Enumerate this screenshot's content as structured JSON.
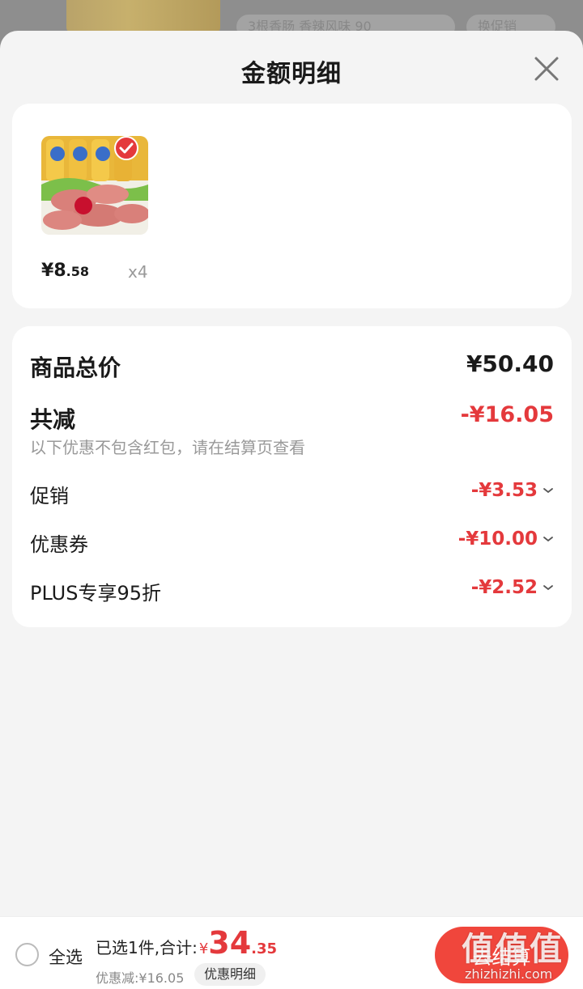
{
  "background": {
    "pill_1": "3根香肠 香辣风味 90",
    "pill_2": "换促销"
  },
  "sheet": {
    "title": "金额明细",
    "close_icon": "close-icon"
  },
  "product": {
    "price_symbol": "¥",
    "price_int": "8",
    "price_dec": ".58",
    "quantity": "x4",
    "selected": true
  },
  "summary": {
    "total_label": "商品总价",
    "total_value": "¥50.40",
    "reduce_label": "共减",
    "reduce_value": "-¥16.05",
    "note": "以下优惠不包含红包，请在结算页查看",
    "items": [
      {
        "label": "促销",
        "value": "-¥3.53"
      },
      {
        "label": "优惠券",
        "value": "-¥10.00"
      },
      {
        "label": "PLUS专享95折",
        "value": "-¥2.52"
      }
    ]
  },
  "bottom": {
    "select_all": "全选",
    "selected_text": "已选1件,合计:",
    "yen": "¥",
    "total_int": "34",
    "total_dec": ".35",
    "discount_text": "优惠减:¥16.05",
    "detail_label": "优惠明细",
    "checkout_label": "去结算"
  },
  "watermark": {
    "big": "值值值",
    "small": "zhizhizhi.com"
  },
  "colors": {
    "accent_red": "#e4393c",
    "checkout_red": "#f0463c",
    "sheet_bg": "#f4f4f4"
  }
}
